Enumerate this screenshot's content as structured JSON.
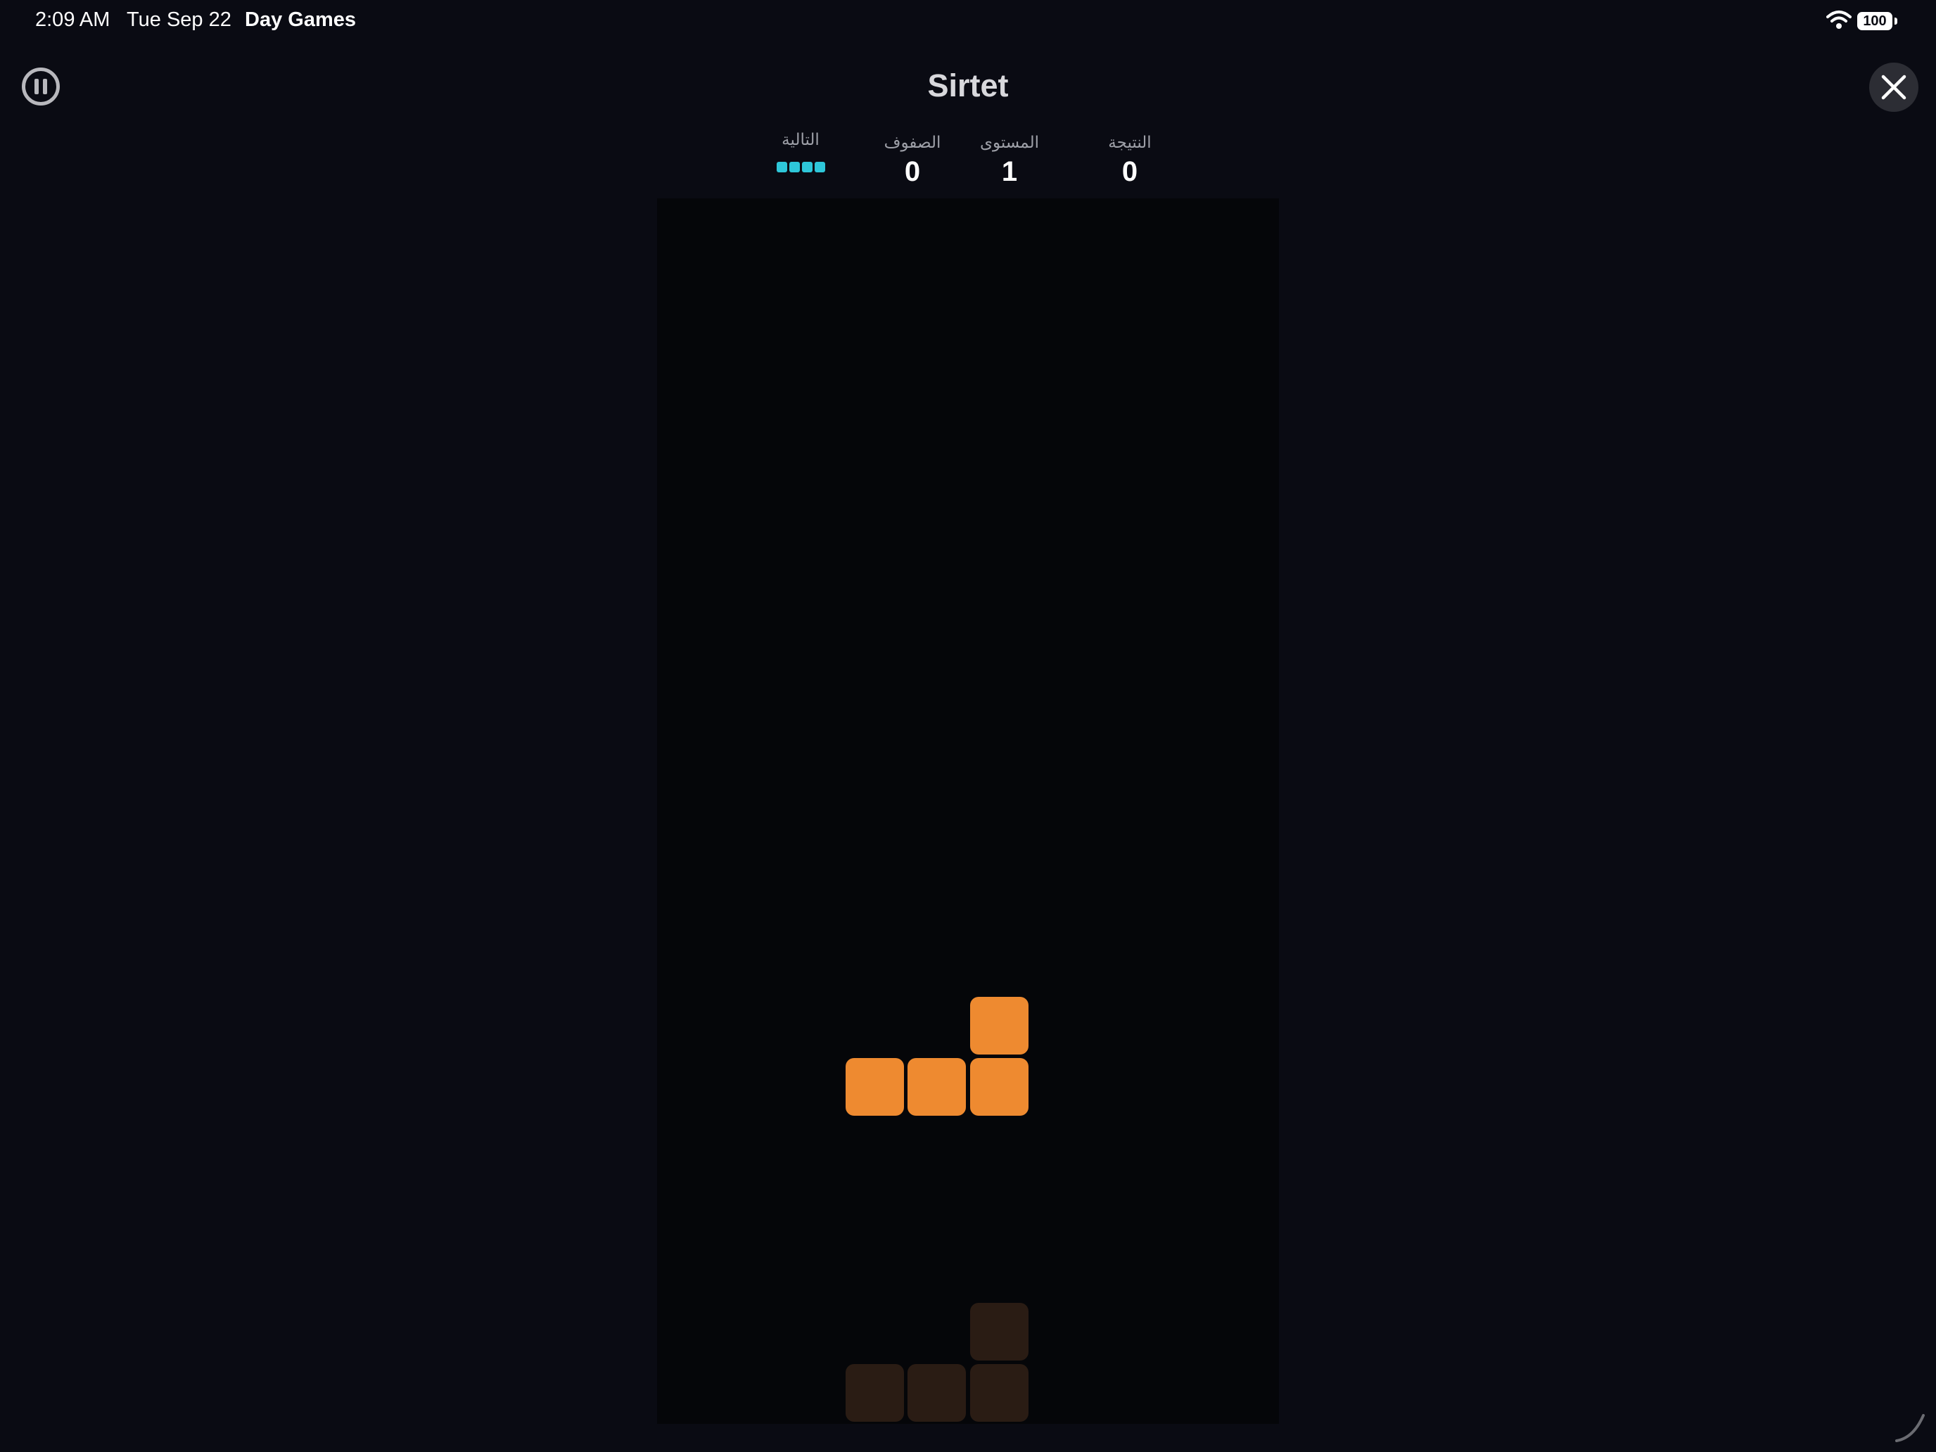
{
  "status_bar": {
    "time": "2:09 AM",
    "date": "Tue Sep 22",
    "app_name": "Day Games",
    "battery": "100"
  },
  "game": {
    "title": "Sirtet",
    "stats": {
      "next_label": "التالية",
      "lines_label": "الصفوف",
      "lines_value": "0",
      "level_label": "المستوى",
      "level_value": "1",
      "score_label": "النتيجة",
      "score_value": "0"
    },
    "next_piece": {
      "type": "I",
      "color": "#2ec7d9",
      "cells": [
        [
          0,
          0
        ],
        [
          1,
          0
        ],
        [
          2,
          0
        ],
        [
          3,
          0
        ]
      ]
    },
    "board": {
      "columns": 10,
      "rows": 20,
      "active_piece": {
        "type": "L",
        "color": "#ee8a30",
        "cells": [
          [
            5,
            13
          ],
          [
            3,
            14
          ],
          [
            4,
            14
          ],
          [
            5,
            14
          ]
        ]
      },
      "ghost_piece": {
        "color": "#2a1c14",
        "cells": [
          [
            5,
            18
          ],
          [
            3,
            19
          ],
          [
            4,
            19
          ],
          [
            5,
            19
          ]
        ]
      }
    }
  },
  "colors": {
    "background": "#0a0b13",
    "board_background": "#050609",
    "stat_label": "#9ea0a8",
    "title": "#d8d8dc"
  },
  "icons": {
    "pause": "pause-circle-icon",
    "close": "close-x-icon",
    "wifi": "wifi-icon",
    "battery": "battery-icon"
  }
}
